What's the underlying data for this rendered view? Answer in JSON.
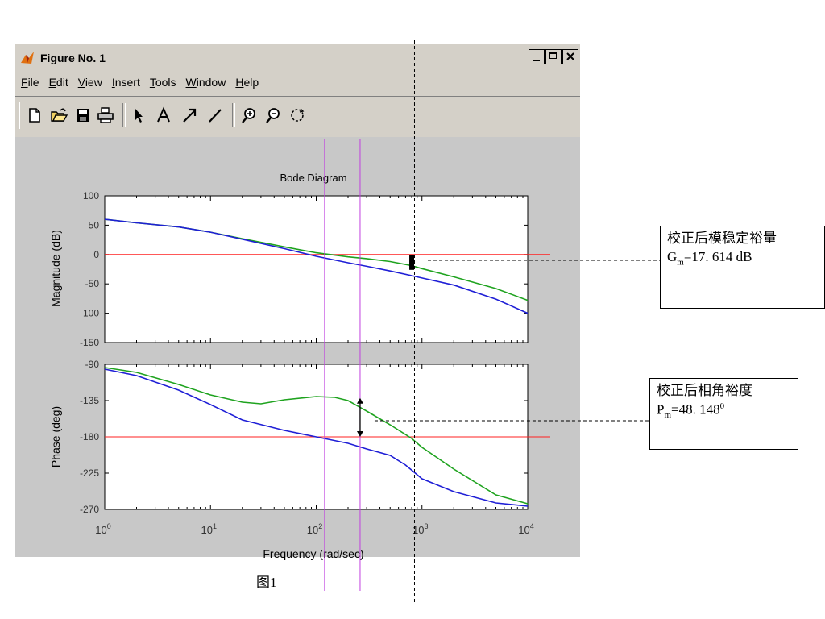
{
  "window": {
    "title": "Figure No. 1",
    "menu": [
      {
        "key": "F",
        "rest": "ile"
      },
      {
        "key": "E",
        "rest": "dit"
      },
      {
        "key": "V",
        "rest": "iew"
      },
      {
        "key": "I",
        "rest": "nsert"
      },
      {
        "key": "T",
        "rest": "ools"
      },
      {
        "key": "W",
        "rest": "indow"
      },
      {
        "key": "H",
        "rest": "elp"
      }
    ],
    "toolbar": [
      "new-file-icon",
      "open-folder-icon",
      "save-disk-icon",
      "print-icon",
      "select-arrow-icon",
      "insert-text-icon",
      "insert-arrow-icon",
      "insert-line-icon",
      "zoom-in-icon",
      "zoom-out-icon",
      "rotate-3d-icon"
    ]
  },
  "chart_data": {
    "type": "line",
    "title": "Bode Diagram",
    "xlabel": "Frequency (rad/sec)",
    "xscale": "log",
    "xlim": [
      1,
      10000
    ],
    "x_ticks": [
      {
        "base": "10",
        "exp": "0"
      },
      {
        "base": "10",
        "exp": "1"
      },
      {
        "base": "10",
        "exp": "2"
      },
      {
        "base": "10",
        "exp": "3"
      },
      {
        "base": "10",
        "exp": "4"
      }
    ],
    "colors": {
      "original": "#1f1fd6",
      "corrected": "#1fa31f",
      "reference": "#ff2020",
      "vertical_markers": "#c040e0",
      "dashed": "#000000"
    },
    "magnitude": {
      "ylabel": "Magnitude (dB)",
      "ylim": [
        -150,
        100
      ],
      "yticks": [
        "100",
        "50",
        "0",
        "-50",
        "-100",
        "-150"
      ],
      "reference_line": 0,
      "series": [
        {
          "color": "#1fa31f",
          "x": [
            1,
            2,
            5,
            10,
            20,
            50,
            100,
            200,
            300,
            500,
            800,
            1000,
            2000,
            5000,
            10000
          ],
          "y": [
            60,
            54,
            47,
            38,
            27,
            13,
            3,
            -4,
            -7,
            -12,
            -19,
            -24,
            -38,
            -58,
            -78
          ]
        },
        {
          "color": "#1f1fd6",
          "x": [
            1,
            2,
            5,
            10,
            20,
            50,
            100,
            200,
            300,
            500,
            800,
            1000,
            2000,
            5000,
            10000
          ],
          "y": [
            60,
            54,
            47,
            38,
            26,
            10,
            -3,
            -14,
            -20,
            -28,
            -36,
            -40,
            -52,
            -76,
            -100
          ]
        }
      ]
    },
    "phase": {
      "ylabel": "Phase (deg)",
      "ylim": [
        -270,
        -90
      ],
      "yticks": [
        "-90",
        "-135",
        "-180",
        "-225",
        "-270"
      ],
      "reference_line": -180,
      "series": [
        {
          "color": "#1fa31f",
          "x": [
            1,
            2,
            5,
            10,
            20,
            30,
            50,
            100,
            150,
            200,
            300,
            500,
            800,
            1000,
            2000,
            5000,
            10000
          ],
          "y": [
            -94,
            -100,
            -115,
            -128,
            -137,
            -139,
            -134,
            -130,
            -131,
            -135,
            -148,
            -165,
            -182,
            -193,
            -220,
            -252,
            -263
          ]
        },
        {
          "color": "#1f1fd6",
          "x": [
            1,
            2,
            5,
            10,
            20,
            50,
            100,
            200,
            300,
            500,
            700,
            1000,
            2000,
            5000,
            10000
          ],
          "y": [
            -96,
            -104,
            -122,
            -140,
            -159,
            -172,
            -180,
            -188,
            -195,
            -203,
            -215,
            -232,
            -248,
            -262,
            -266
          ]
        }
      ]
    },
    "vertical_markers_x": [
      120,
      260
    ],
    "dashed_marker_x": 850,
    "gain_margin_marker": {
      "x": 800,
      "y_from": -18.5,
      "y_to": -20.5
    },
    "phase_margin_marker": {
      "x": 260,
      "y_from": -131.8,
      "y_to": -180
    }
  },
  "annotations": {
    "gain_margin": {
      "line1": "校正后模稳定裕量",
      "prefix": "G",
      "sub": "m",
      "value": "=17. 614  dB"
    },
    "phase_margin": {
      "line1": "校正后相角裕度",
      "prefix": "P",
      "sub": "m",
      "value": "=48. 148",
      "sup": "0"
    }
  },
  "caption": "图1"
}
